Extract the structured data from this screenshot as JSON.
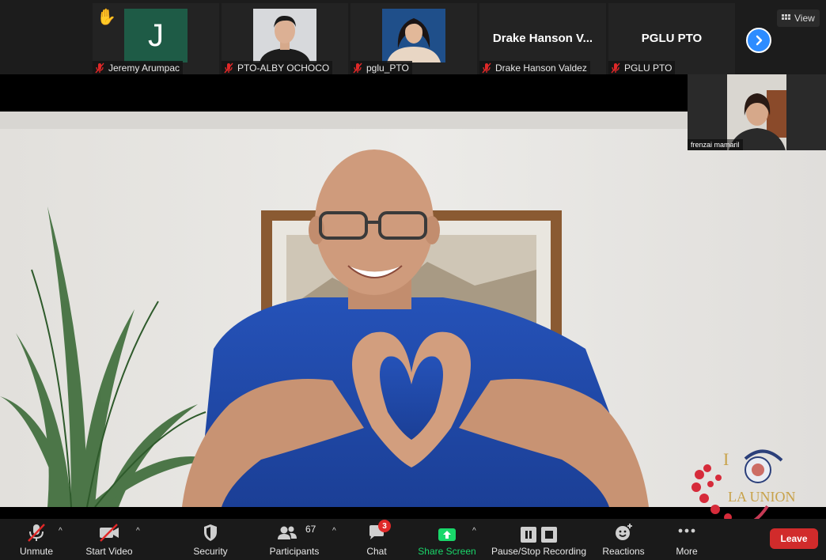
{
  "participants": [
    {
      "name": "Jeremy Arumpac",
      "initial": "J",
      "muted": true,
      "raised_hand": true
    },
    {
      "name": "PTO-ALBY OCHOCO",
      "muted": true
    },
    {
      "name": "pglu_PTO",
      "muted": true
    },
    {
      "name": "Drake Hanson Valdez",
      "display_title": "Drake Hanson V...",
      "muted": true
    },
    {
      "name": "PGLU PTO",
      "display_title": "PGLU PTO",
      "muted": true
    }
  ],
  "view_label": "View",
  "self_view": {
    "name": "frenzai mamaril"
  },
  "logo": {
    "text_i": "I",
    "text_place": "LA UNION"
  },
  "toolbar": {
    "unmute": "Unmute",
    "start_video": "Start Video",
    "security": "Security",
    "participants": "Participants",
    "participants_count": "67",
    "chat": "Chat",
    "chat_badge": "3",
    "share_screen": "Share Screen",
    "recording": "Pause/Stop Recording",
    "reactions": "Reactions",
    "more": "More",
    "leave": "Leave"
  },
  "colors": {
    "accent_blue": "#2d8cff",
    "share_green": "#19d76a",
    "leave_red": "#d12b2b",
    "mic_off_red": "#e02828",
    "avatar_green": "#1e5b46"
  }
}
